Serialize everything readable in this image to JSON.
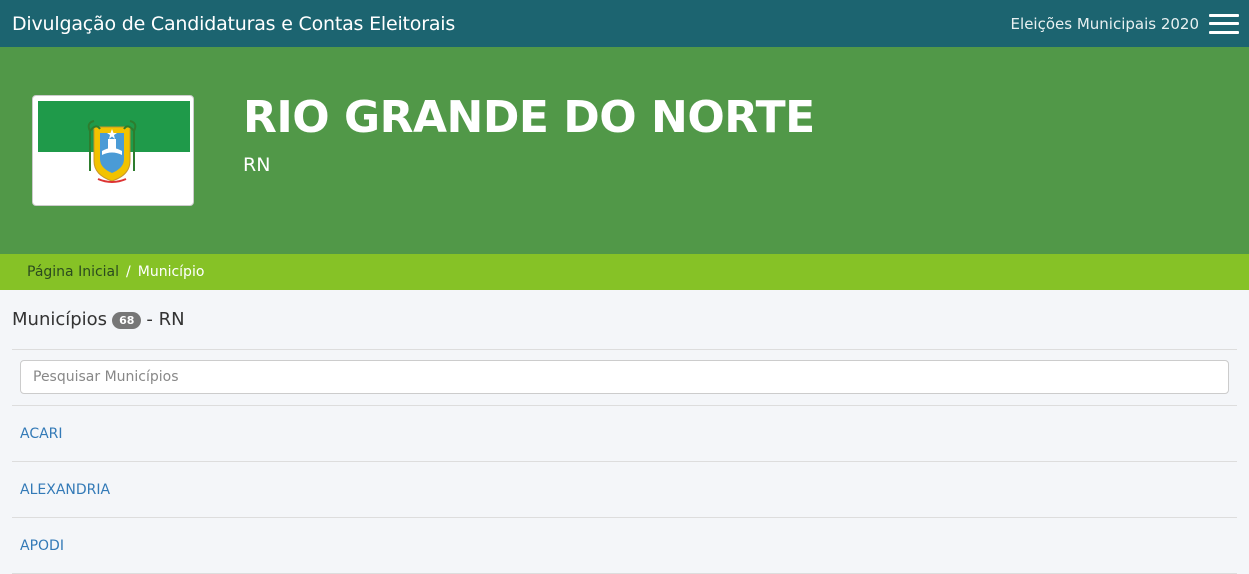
{
  "topbar": {
    "app_title": "Divulgação de Candidaturas e Contas Eleitorais",
    "election": "Eleições Municipais 2020"
  },
  "hero": {
    "state_name": "RIO GRANDE DO NORTE",
    "state_abbr": "RN"
  },
  "breadcrumb": {
    "home": "Página Inicial",
    "separator": "/",
    "current": "Município"
  },
  "list": {
    "title": "Municípios",
    "count": "68",
    "suffix": "- RN",
    "search_placeholder": "Pesquisar Municípios",
    "items": [
      "ACARI",
      "ALEXANDRIA",
      "APODI"
    ]
  },
  "colors": {
    "topbar": "#1c6470",
    "hero": "#519848",
    "breadcrumb": "#86c226",
    "link": "#337ab7"
  }
}
